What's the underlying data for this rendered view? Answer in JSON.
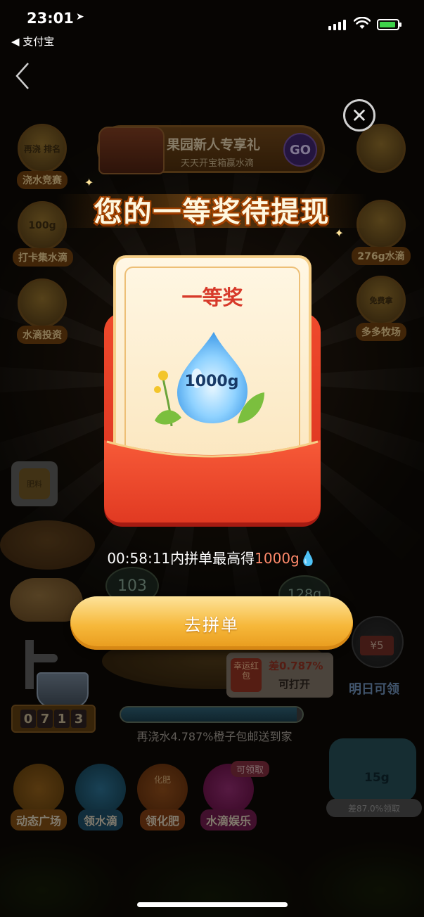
{
  "status_bar": {
    "time": "23:01",
    "back_app": "◀ 支付宝"
  },
  "background": {
    "banner": {
      "title": "果园新人专享礼",
      "subtitle": "天天开宝箱赢水滴",
      "go": "GO"
    },
    "left_buttons": [
      {
        "label": "浇水竞赛",
        "badge": "再浇  排名"
      },
      {
        "label": "打卡集水滴",
        "badge": "100g"
      },
      {
        "label": "水滴投资",
        "badge": ""
      }
    ],
    "right_buttons": [
      {
        "label": "276g水滴",
        "badge": ""
      },
      {
        "label": "多多牧场",
        "badge": "免费拿"
      }
    ],
    "fertilizer_badge": "肥料",
    "bubble_left": "103",
    "bubble_right": "128g",
    "counter_digits": [
      "0",
      "7",
      "1",
      "3"
    ],
    "lucky_packet": {
      "icon": "幸运红包",
      "line1": "差0.787%",
      "line2": "可打开"
    },
    "progress": {
      "fraction": 0.97,
      "text": "再浇水4.787%橙子包邮送到家"
    },
    "tomorrow": {
      "bill": "¥5",
      "label": "明日可领"
    },
    "watering_can": {
      "value": "15g",
      "tag": "差87.0%领取"
    },
    "bottom_buttons": [
      {
        "label": "动态广场"
      },
      {
        "label": "领水滴"
      },
      {
        "label": "领化肥",
        "badge": "化肥"
      },
      {
        "label": "水滴娱乐",
        "tag": "可领取"
      }
    ]
  },
  "modal": {
    "headline": "您的一等奖待提现",
    "prize_title": "一等奖",
    "prize_amount": "1000g",
    "timer": "00:58:11",
    "timer_mid": "内拼单最高得",
    "timer_amount": "1000g",
    "cta": "去拼单"
  },
  "colors": {
    "accent_red": "#d7392a",
    "envelope": "#e63c26",
    "cta_gold": "#f6b83a"
  }
}
